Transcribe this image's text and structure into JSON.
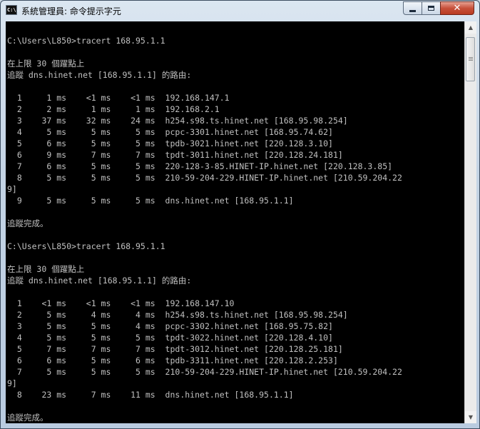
{
  "window": {
    "title": "系統管理員: 命令提示字元",
    "icon_text": "C:\\.",
    "controls": {
      "minimize": "minimize-icon",
      "maximize": "maximize-icon",
      "close": "✕"
    }
  },
  "console": {
    "lines": [
      "",
      "C:\\Users\\L850>tracert 168.95.1.1",
      "",
      "在上限 30 個躍點上",
      "追蹤 dns.hinet.net [168.95.1.1] 的路由:",
      "",
      "  1     1 ms    <1 ms    <1 ms  192.168.147.1",
      "  2     2 ms     1 ms     1 ms  192.168.2.1",
      "  3    37 ms    32 ms    24 ms  h254.s98.ts.hinet.net [168.95.98.254]",
      "  4     5 ms     5 ms     5 ms  pcpc-3301.hinet.net [168.95.74.62]",
      "  5     6 ms     5 ms     5 ms  tpdb-3021.hinet.net [220.128.3.10]",
      "  6     9 ms     7 ms     7 ms  tpdt-3011.hinet.net [220.128.24.181]",
      "  7     6 ms     5 ms     5 ms  220-128-3-85.HINET-IP.hinet.net [220.128.3.85]",
      "  8     5 ms     5 ms     5 ms  210-59-204-229.HINET-IP.hinet.net [210.59.204.22",
      "9]",
      "  9     5 ms     5 ms     5 ms  dns.hinet.net [168.95.1.1]",
      "",
      "追蹤完成。",
      "",
      "C:\\Users\\L850>tracert 168.95.1.1",
      "",
      "在上限 30 個躍點上",
      "追蹤 dns.hinet.net [168.95.1.1] 的路由:",
      "",
      "  1    <1 ms    <1 ms    <1 ms  192.168.147.10",
      "  2     5 ms     4 ms     4 ms  h254.s98.ts.hinet.net [168.95.98.254]",
      "  3     5 ms     5 ms     4 ms  pcpc-3302.hinet.net [168.95.75.82]",
      "  4     5 ms     5 ms     5 ms  tpdt-3022.hinet.net [220.128.4.10]",
      "  5     7 ms     7 ms     7 ms  tpdt-3012.hinet.net [220.128.25.181]",
      "  6     6 ms     5 ms     6 ms  tpdb-3311.hinet.net [220.128.2.253]",
      "  7     5 ms     5 ms     5 ms  210-59-204-229.HINET-IP.hinet.net [210.59.204.22",
      "9]",
      "  8    23 ms     7 ms    11 ms  dns.hinet.net [168.95.1.1]",
      "",
      "追蹤完成。"
    ]
  },
  "scrollbar": {
    "up": "▲",
    "down": "▼"
  },
  "colors": {
    "console_bg": "#000000",
    "console_text": "#c0c0c0",
    "close_button": "#c7503a"
  }
}
